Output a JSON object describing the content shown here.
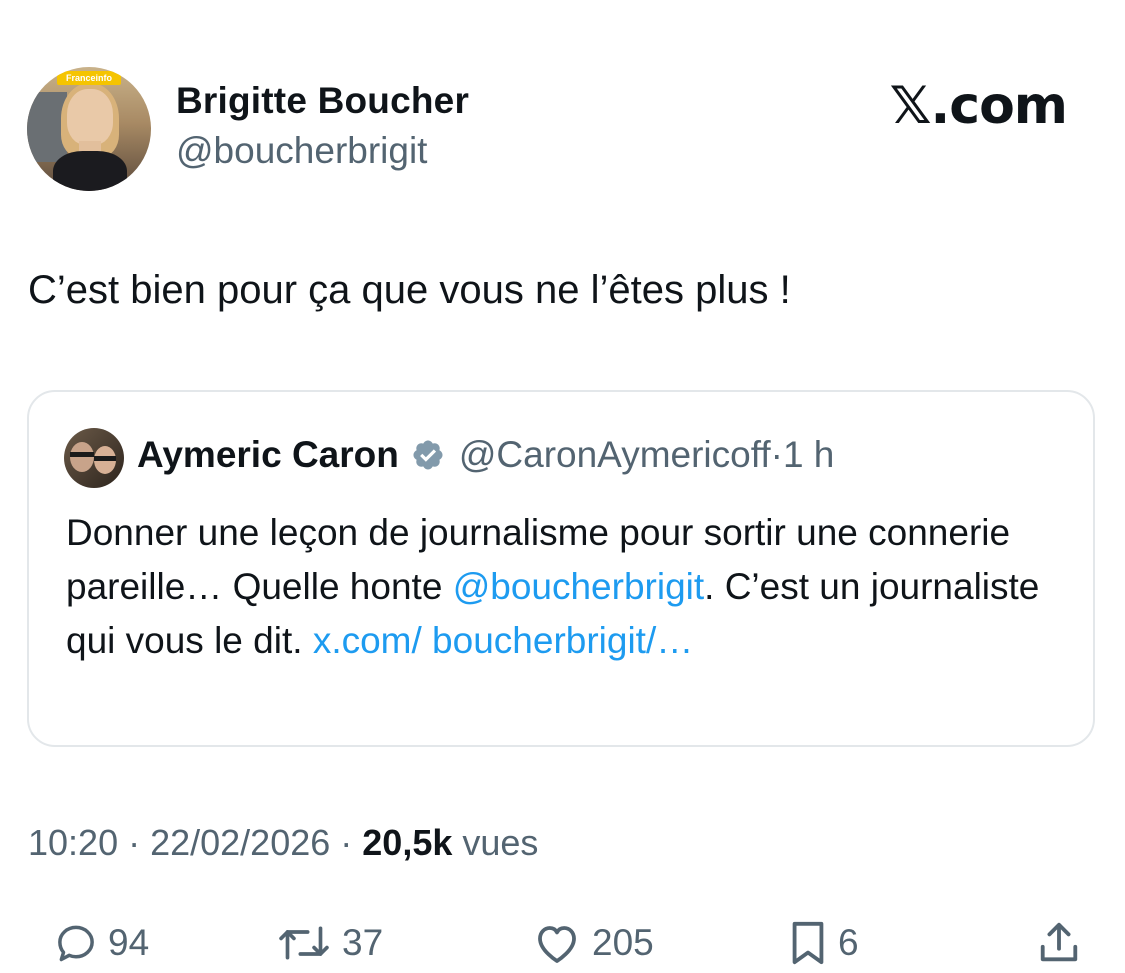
{
  "author": {
    "name": "Brigitte Boucher",
    "handle": "@boucherbrigit",
    "avatar_badge": "Franceinfo"
  },
  "brand": "𝕏.com",
  "tweet": {
    "text": "C’est bien pour ça que vous ne l’êtes plus !"
  },
  "quote": {
    "name": "Aymeric Caron",
    "handle": "@CaronAymericoff",
    "dot": "·",
    "time": "1 h",
    "text_part1": "Donner une leçon de journalisme pour sortir une connerie pareille… Quelle honte ",
    "mention": "@boucherbrigit",
    "text_part2": ". C’est un journaliste qui vous le dit. ",
    "link": "x.com/ boucherbrigit/…",
    "verified_icon": "verified-badge-icon"
  },
  "meta": {
    "time": "10:20",
    "sep1": " · ",
    "date": "22/02/2026",
    "sep2": " · ",
    "views_count": "20,5k",
    "views_label": " vues"
  },
  "actions": {
    "replies": "94",
    "retweets": "37",
    "likes": "205",
    "bookmarks": "6"
  },
  "colors": {
    "link": "#1d9bf0",
    "secondary_text": "#536471",
    "border": "#e3e7ea"
  }
}
